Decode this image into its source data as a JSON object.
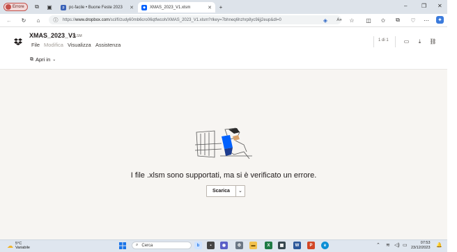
{
  "browser": {
    "profile_label": "Errore",
    "tabs": [
      {
        "title": "pc-facile • Buone Feste 2023",
        "active": false
      },
      {
        "title": "XMAS_2023_V1.xlsm",
        "active": true
      }
    ],
    "new_tab": "+",
    "url_prefix": "https://",
    "url_host": "www.dropbox.com",
    "url_path": "/scl/fi/zudy60mb6cro06qtfwcoh/XMAS_2023_V1.xlsm?rlkey=7bhneq6hzhrp8yc9iijj2eup&dl=0",
    "window_controls": [
      "–",
      "❐",
      "✕"
    ]
  },
  "app": {
    "file_name": "XMAS_2023_V1",
    "file_ext": "XLSM",
    "menu": [
      "File",
      "Modifica",
      "Visualizza",
      "Assistenza"
    ],
    "page_count": "1 di 1",
    "open_in_label": "Apri in"
  },
  "error": {
    "message": "I file .xlsm sono supportati, ma si è verificato un errore.",
    "download_label": "Scarica",
    "dropdown_icon": "chevron-down-icon"
  },
  "taskbar": {
    "weather_temp": "5°C",
    "weather_desc": "Variabile",
    "search_placeholder": "Cerca",
    "time": "07:53",
    "date": "23/12/2023"
  },
  "colors": {
    "accent": "#0061fe",
    "error_profile": "#c4504a",
    "page_bg": "#f7f5f2"
  }
}
